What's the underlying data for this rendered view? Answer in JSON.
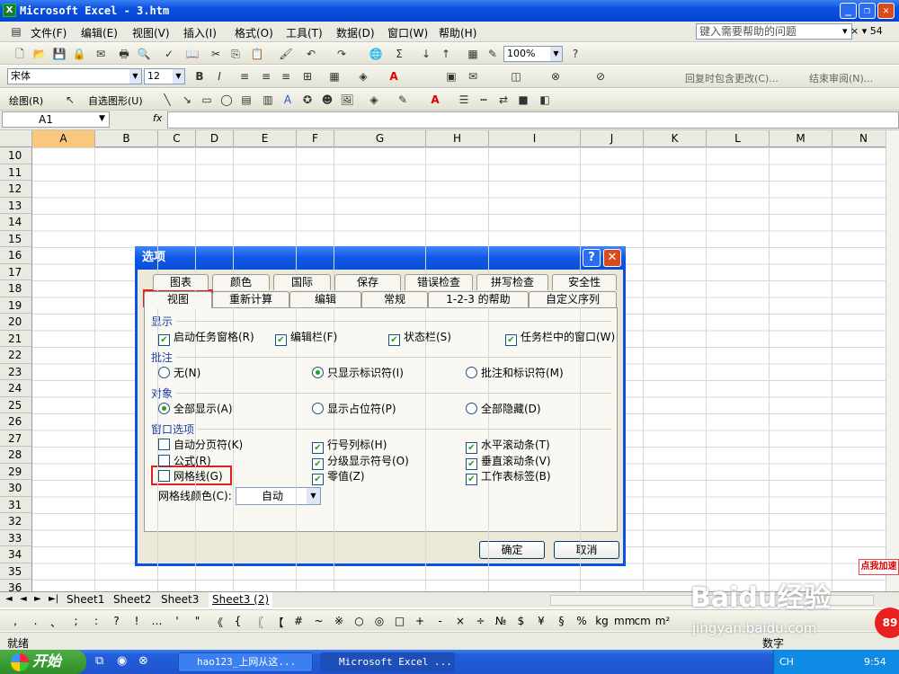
{
  "window": {
    "title": "Microsoft Excel - 3.htm",
    "icon": "excel-icon"
  },
  "menu": {
    "items": [
      "文件(F)",
      "编辑(E)",
      "视图(V)",
      "插入(I)",
      "格式(O)",
      "工具(T)",
      "数据(D)",
      "窗口(W)",
      "帮助(H)"
    ],
    "help_placeholder": "键入需要帮助的问题",
    "ctl_right": "▾ × ▾ 54"
  },
  "toolbar": {
    "zoom": "100%",
    "font": "宋体",
    "size": "12",
    "review_text": "回复时包含更改(C)...",
    "end_review": "结束审阅(N)...",
    "draw_label": "绘图(R)",
    "autoshape_label": "自选图形(U)"
  },
  "formula": {
    "cell": "A1",
    "fx": "fx"
  },
  "grid": {
    "columns": [
      "A",
      "B",
      "C",
      "D",
      "E",
      "F",
      "G",
      "H",
      "I",
      "J",
      "K",
      "L",
      "M",
      "N"
    ],
    "rows": [
      "10",
      "11",
      "12",
      "13",
      "14",
      "15",
      "16",
      "17",
      "18",
      "19",
      "20",
      "21",
      "22",
      "23",
      "24",
      "25",
      "26",
      "27",
      "28",
      "29",
      "30",
      "31",
      "32",
      "33",
      "34",
      "35",
      "36"
    ]
  },
  "sheets": {
    "tabs": [
      "Sheet1",
      "Sheet2",
      "Sheet3",
      "Sheet3 (2)"
    ],
    "active": 3
  },
  "symbols": [
    ",",
    ".",
    "、",
    ";",
    ":",
    "?",
    "!",
    "…",
    "'",
    "\"",
    "《",
    "{",
    "〖",
    "【",
    "#",
    "~",
    "※",
    "○",
    "◎",
    "□",
    "+",
    "-",
    "×",
    "÷",
    "№",
    "$",
    "¥",
    "§",
    "%",
    "kg",
    "mm",
    "cm",
    "m²"
  ],
  "status": {
    "left": "就绪",
    "right": "数字"
  },
  "taskbar": {
    "start": "开始",
    "items": [
      "hao123_上网从这...",
      "Microsoft Excel ..."
    ],
    "tray_lang": "CH",
    "clock": "9:54"
  },
  "dialog": {
    "title": "选项",
    "tabs_row1": [
      "图表",
      "颜色",
      "国际",
      "保存",
      "错误检查",
      "拼写检查",
      "安全性"
    ],
    "tabs_row2": [
      "视图",
      "重新计算",
      "编辑",
      "常规",
      "1-2-3 的帮助",
      "自定义序列"
    ],
    "sections": {
      "show": {
        "label": "显示",
        "items": [
          {
            "text": "启动任务窗格(R)",
            "checked": true
          },
          {
            "text": "编辑栏(F)",
            "checked": true
          },
          {
            "text": "状态栏(S)",
            "checked": true
          },
          {
            "text": "任务栏中的窗口(W)",
            "checked": true
          }
        ]
      },
      "comment": {
        "label": "批注",
        "items": [
          {
            "text": "无(N)",
            "selected": false
          },
          {
            "text": "只显示标识符(I)",
            "selected": true
          },
          {
            "text": "批注和标识符(M)",
            "selected": false
          }
        ]
      },
      "object": {
        "label": "对象",
        "items": [
          {
            "text": "全部显示(A)",
            "selected": true
          },
          {
            "text": "显示占位符(P)",
            "selected": false
          },
          {
            "text": "全部隐藏(D)",
            "selected": false
          }
        ]
      },
      "window": {
        "label": "窗口选项",
        "items": [
          {
            "text": "自动分页符(K)",
            "checked": false
          },
          {
            "text": "行号列标(H)",
            "checked": true
          },
          {
            "text": "水平滚动条(T)",
            "checked": true
          },
          {
            "text": "公式(R)",
            "checked": false
          },
          {
            "text": "分级显示符号(O)",
            "checked": true
          },
          {
            "text": "垂直滚动条(V)",
            "checked": true
          },
          {
            "text": "网格线(G)",
            "checked": false
          },
          {
            "text": "零值(Z)",
            "checked": true
          },
          {
            "text": "工作表标签(B)",
            "checked": true
          }
        ]
      }
    },
    "gridcolor_label": "网格线颜色(C):",
    "gridcolor_value": "自动",
    "ok": "确定",
    "cancel": "取消"
  },
  "watermark": {
    "brand": "Baidu经验",
    "url": "jingyan.baidu.com",
    "badge": "点我加速",
    "badge_num": "89"
  }
}
